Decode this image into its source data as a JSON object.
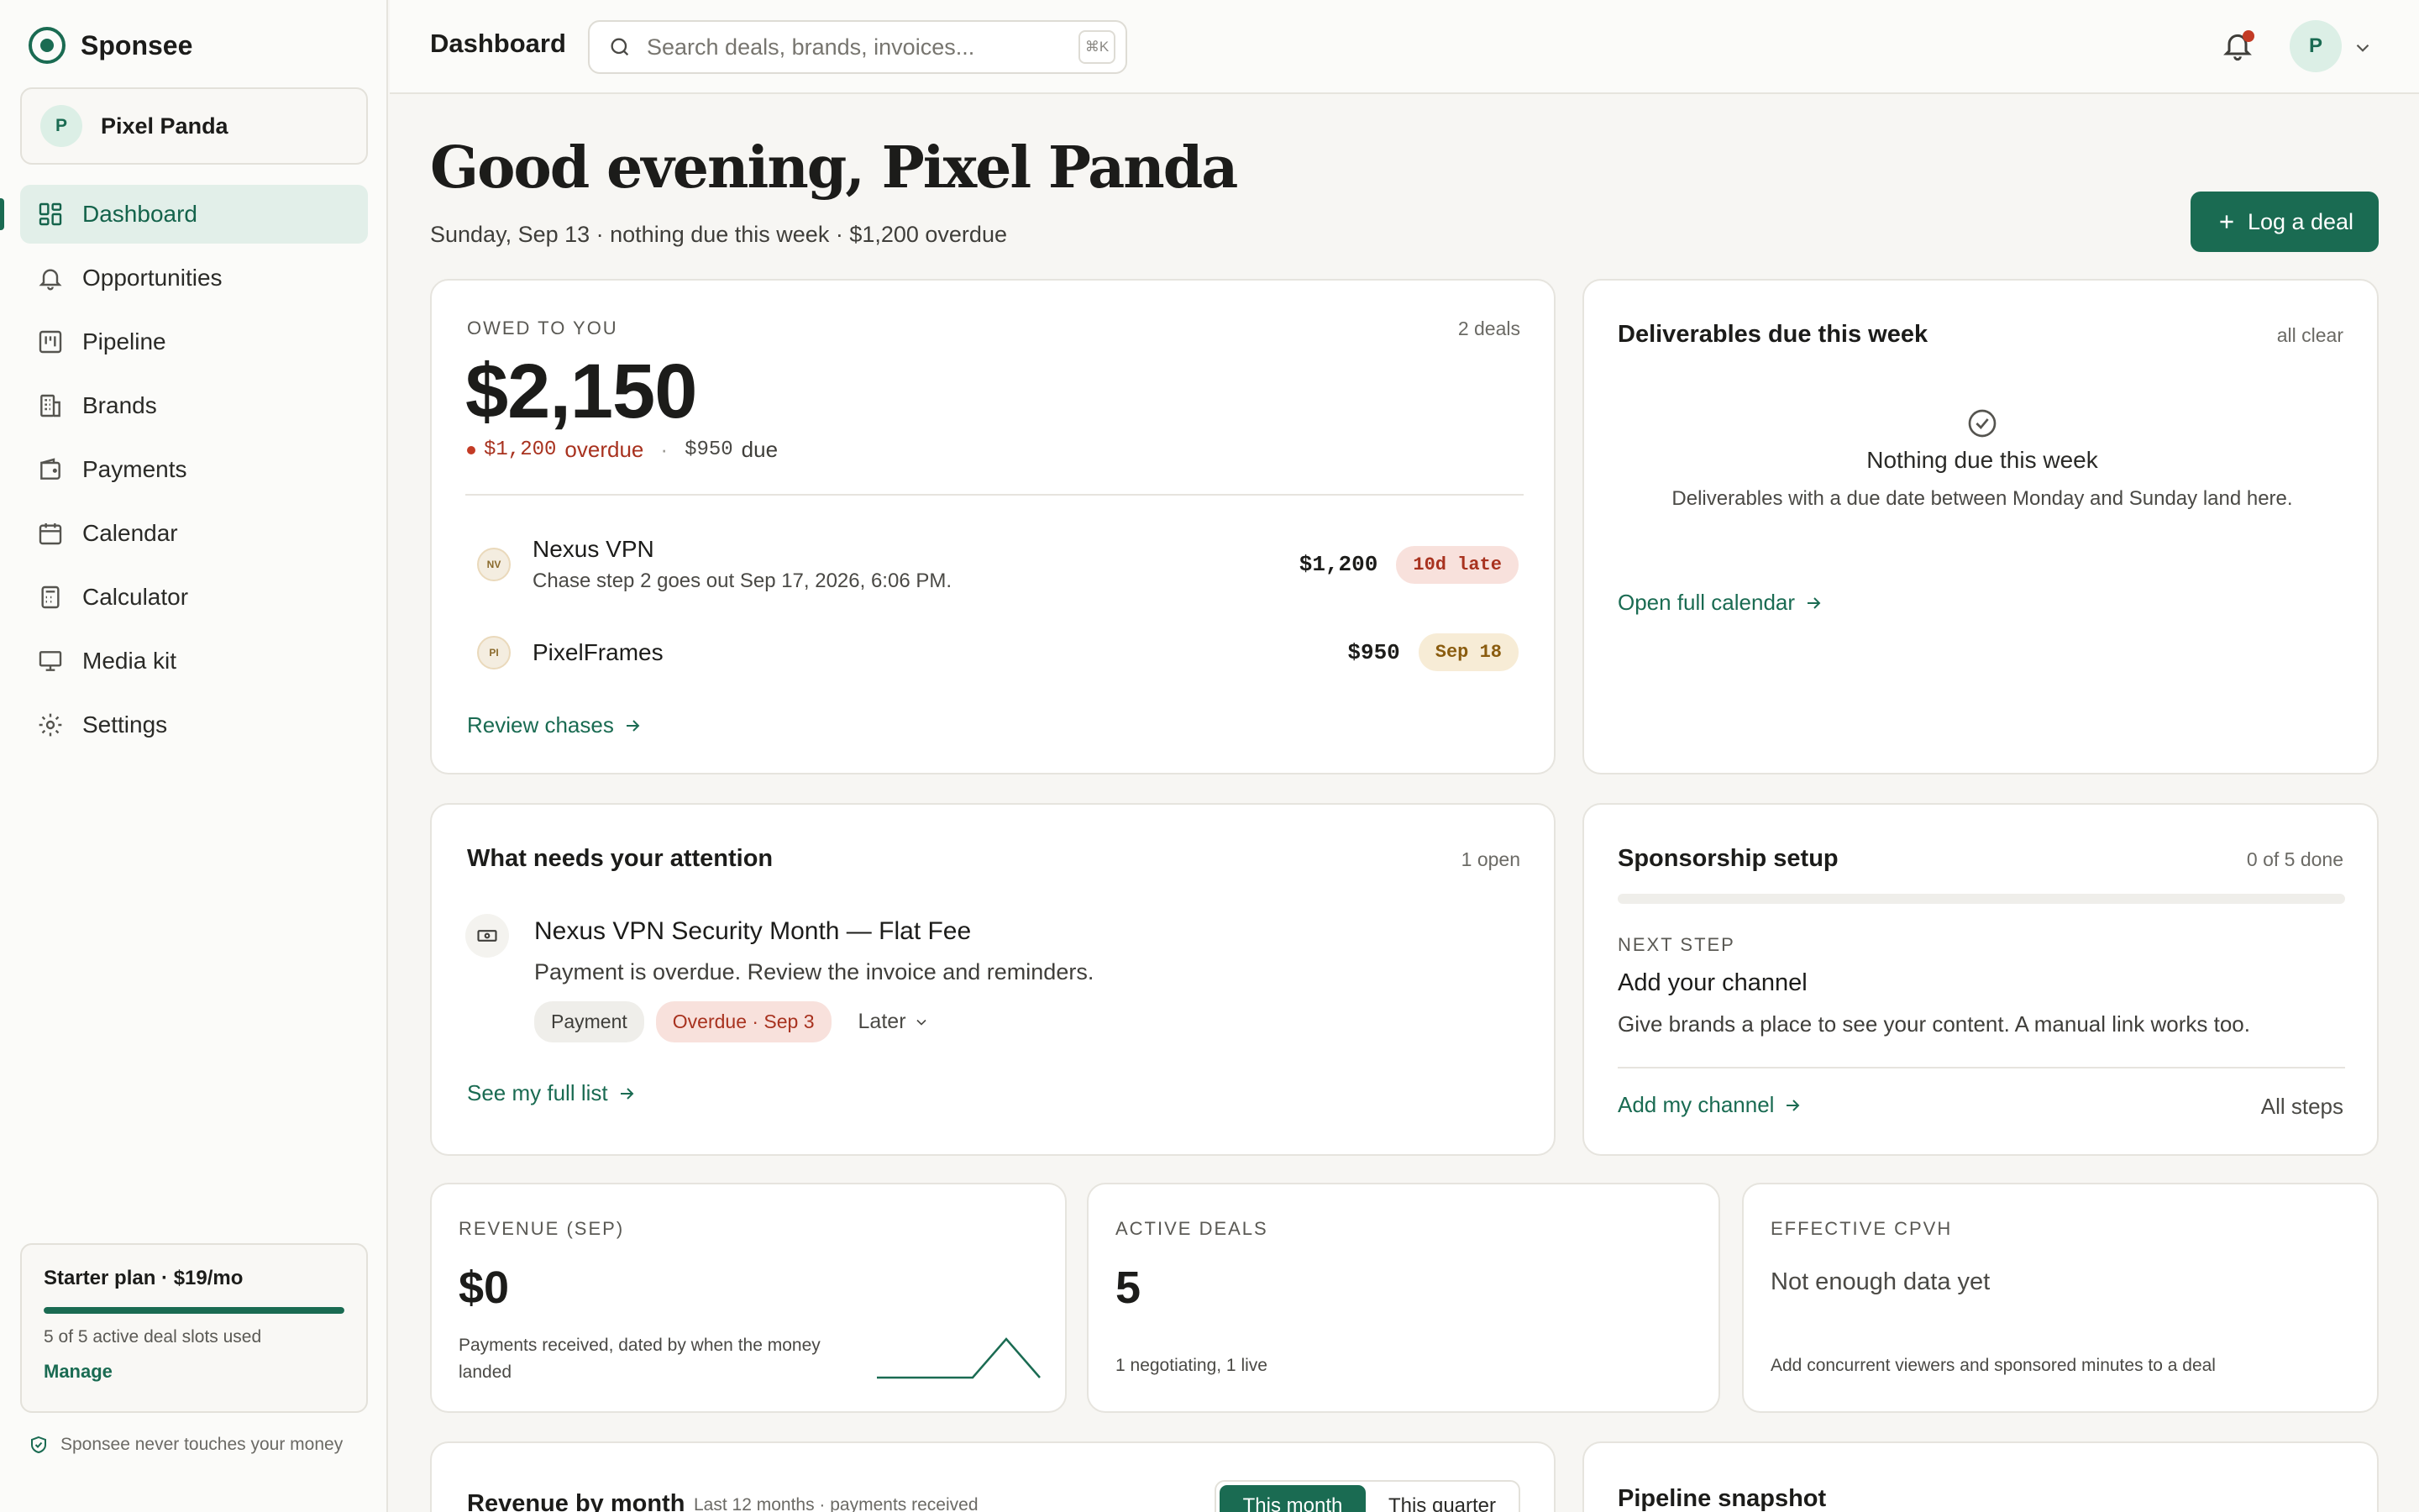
{
  "app": {
    "name": "Sponsee",
    "workspace": "Pixel Panda",
    "workspace_initial": "P"
  },
  "sidebar": {
    "items": [
      {
        "label": "Dashboard",
        "icon": "dashboard-icon",
        "active": true
      },
      {
        "label": "Opportunities",
        "icon": "bell-icon"
      },
      {
        "label": "Pipeline",
        "icon": "kanban-icon"
      },
      {
        "label": "Brands",
        "icon": "building-icon"
      },
      {
        "label": "Payments",
        "icon": "wallet-icon"
      },
      {
        "label": "Calendar",
        "icon": "calendar-icon"
      },
      {
        "label": "Calculator",
        "icon": "calculator-icon"
      },
      {
        "label": "Media kit",
        "icon": "presentation-icon"
      },
      {
        "label": "Settings",
        "icon": "gear-icon"
      }
    ],
    "plan": {
      "title": "Starter plan · $19/mo",
      "usage": "5 of 5 active deal slots used",
      "used": 5,
      "total": 5,
      "manage": "Manage"
    },
    "trust": "Sponsee never touches your money"
  },
  "topbar": {
    "title": "Dashboard",
    "search_placeholder": "Search deals, brands, invoices...",
    "shortcut": "⌘K",
    "user_initial": "P"
  },
  "header": {
    "greeting": "Good evening, Pixel Panda",
    "subtitle": "Sunday, Sep 13 · nothing due this week · $1,200 overdue",
    "log_button": "Log a deal"
  },
  "owed": {
    "label": "OWED TO YOU",
    "count": "2 deals",
    "amount": "$2,150",
    "overdue_amount": "$1,200",
    "overdue_word": "overdue",
    "sep": "·",
    "due_amount": "$950",
    "due_word": "due",
    "rows": [
      {
        "initials": "NV",
        "name": "Nexus VPN",
        "desc": "Chase step 2 goes out Sep 17, 2026, 6:06 PM.",
        "amount": "$1,200",
        "badge": "10d late"
      },
      {
        "initials": "PI",
        "name": "PixelFrames",
        "desc": "",
        "amount": "$950",
        "badge": "Sep 18"
      }
    ],
    "link": "Review chases"
  },
  "deliverables": {
    "title": "Deliverables due this week",
    "meta": "all clear",
    "empty_title": "Nothing due this week",
    "empty_desc": "Deliverables with a due date between Monday and Sunday land here.",
    "link": "Open full calendar"
  },
  "attention": {
    "title": "What needs your attention",
    "meta": "1 open",
    "item_title": "Nexus VPN Security Month — Flat Fee",
    "item_desc": "Payment is overdue. Review the invoice and reminders.",
    "tag_type": "Payment",
    "tag_status": "Overdue · Sep 3",
    "later": "Later",
    "link": "See my full list"
  },
  "setup": {
    "title": "Sponsorship setup",
    "meta": "0 of 5 done",
    "progress": 0,
    "next_label": "NEXT STEP",
    "step_title": "Add your channel",
    "step_desc": "Give brands a place to see your content. A manual link works too.",
    "link": "Add my channel",
    "all_steps": "All steps"
  },
  "stats": {
    "revenue": {
      "label": "REVENUE (SEP)",
      "value": "$0",
      "note": "Payments received, dated by when the money landed"
    },
    "deals": {
      "label": "ACTIVE DEALS",
      "value": "5",
      "note": "1 negotiating, 1 live"
    },
    "cpvh": {
      "label": "EFFECTIVE CPVH",
      "value": "Not enough data yet",
      "note": "Add concurrent viewers and sponsored minutes to a deal"
    }
  },
  "revenue_chart": {
    "title": "Revenue by month",
    "subtitle": "Last 12 months · payments received",
    "toggle": [
      "This month",
      "This quarter"
    ]
  },
  "pipeline": {
    "title": "Pipeline snapshot"
  },
  "colors": {
    "accent": "#1a6b52",
    "danger": "#c33b25",
    "warning": "#8a5c0f"
  }
}
